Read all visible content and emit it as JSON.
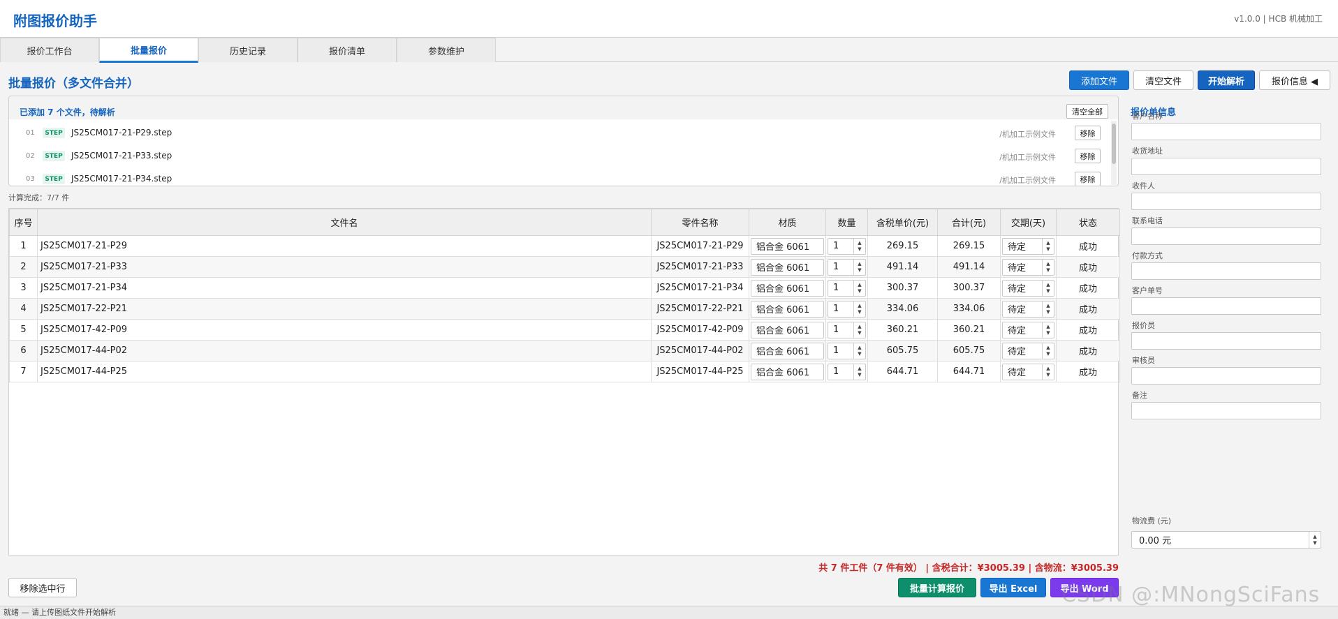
{
  "app": {
    "title": "附图报价助手",
    "version": "v1.0.0  |  HCB 机械加工"
  },
  "tabs": [
    {
      "label": "报价工作台"
    },
    {
      "label": "批量报价"
    },
    {
      "label": "历史记录"
    },
    {
      "label": "报价清单"
    },
    {
      "label": "参数维护"
    }
  ],
  "main": {
    "title": "批量报价（多文件合并）",
    "buttons": {
      "add_file": "添加文件",
      "clear_files": "清空文件",
      "start_parse": "开始解析",
      "quote_info": "报价信息 ◀"
    }
  },
  "filebox": {
    "title": "已添加 7 个文件，待解析",
    "clear_all": "清空全部",
    "files": [
      {
        "idx": "01",
        "badge": "STEP",
        "name": "JS25CM017-21-P29.step",
        "path": "/机加工示例文件",
        "remove": "移除"
      },
      {
        "idx": "02",
        "badge": "STEP",
        "name": "JS25CM017-21-P33.step",
        "path": "/机加工示例文件",
        "remove": "移除"
      },
      {
        "idx": "03",
        "badge": "STEP",
        "name": "JS25CM017-21-P34.step",
        "path": "/机加工示例文件",
        "remove": "移除"
      }
    ]
  },
  "calc_status": "计算完成：7/7 件",
  "table": {
    "headers": [
      "序号",
      "文件名",
      "零件名称",
      "材质",
      "数量",
      "含税单价(元)",
      "合计(元)",
      "交期(天)",
      "状态"
    ],
    "rows": [
      {
        "no": "1",
        "file": "JS25CM017-21-P29",
        "part": "JS25CM017-21-P29",
        "material": "铝合金 6061",
        "qty": "1",
        "unit": "269.15",
        "total": "269.15",
        "lead": "待定",
        "status": "成功"
      },
      {
        "no": "2",
        "file": "JS25CM017-21-P33",
        "part": "JS25CM017-21-P33",
        "material": "铝合金 6061",
        "qty": "1",
        "unit": "491.14",
        "total": "491.14",
        "lead": "待定",
        "status": "成功"
      },
      {
        "no": "3",
        "file": "JS25CM017-21-P34",
        "part": "JS25CM017-21-P34",
        "material": "铝合金 6061",
        "qty": "1",
        "unit": "300.37",
        "total": "300.37",
        "lead": "待定",
        "status": "成功"
      },
      {
        "no": "4",
        "file": "JS25CM017-22-P21",
        "part": "JS25CM017-22-P21",
        "material": "铝合金 6061",
        "qty": "1",
        "unit": "334.06",
        "total": "334.06",
        "lead": "待定",
        "status": "成功"
      },
      {
        "no": "5",
        "file": "JS25CM017-42-P09",
        "part": "JS25CM017-42-P09",
        "material": "铝合金 6061",
        "qty": "1",
        "unit": "360.21",
        "total": "360.21",
        "lead": "待定",
        "status": "成功"
      },
      {
        "no": "6",
        "file": "JS25CM017-44-P02",
        "part": "JS25CM017-44-P02",
        "material": "铝合金 6061",
        "qty": "1",
        "unit": "605.75",
        "total": "605.75",
        "lead": "待定",
        "status": "成功"
      },
      {
        "no": "7",
        "file": "JS25CM017-44-P25",
        "part": "JS25CM017-44-P25",
        "material": "铝合金 6061",
        "qty": "1",
        "unit": "644.71",
        "total": "644.71",
        "lead": "待定",
        "status": "成功"
      }
    ]
  },
  "totals": "共 7 件工件（7 件有效）  |  含税合计：¥3005.39  |  含物流：¥3005.39",
  "bottom_buttons": {
    "remove_selected": "移除选中行",
    "batch_calc": "批量计算报价",
    "export_excel": "导出 Excel",
    "export_word": "导出 Word"
  },
  "side_panel": {
    "title": "报价单信息",
    "fields": [
      {
        "label": "客户名称",
        "value": ""
      },
      {
        "label": "收货地址",
        "value": ""
      },
      {
        "label": "收件人",
        "value": ""
      },
      {
        "label": "联系电话",
        "value": ""
      },
      {
        "label": "付款方式",
        "value": ""
      },
      {
        "label": "客户单号",
        "value": ""
      },
      {
        "label": "报价员",
        "value": ""
      },
      {
        "label": "审核员",
        "value": ""
      },
      {
        "label": "备注",
        "value": ""
      }
    ],
    "logistics": {
      "label": "物流费 (元)",
      "value": "0.00 元"
    }
  },
  "status_bar": "就绪 — 请上传图纸文件开始解析",
  "watermark": "CSDN @:MNongSciFans",
  "colors": {
    "accent": "#1565c0",
    "button_blue": "#1976d2",
    "green": "#0d8f6b",
    "purple": "#7c3aed",
    "total_red": "#c62828"
  }
}
